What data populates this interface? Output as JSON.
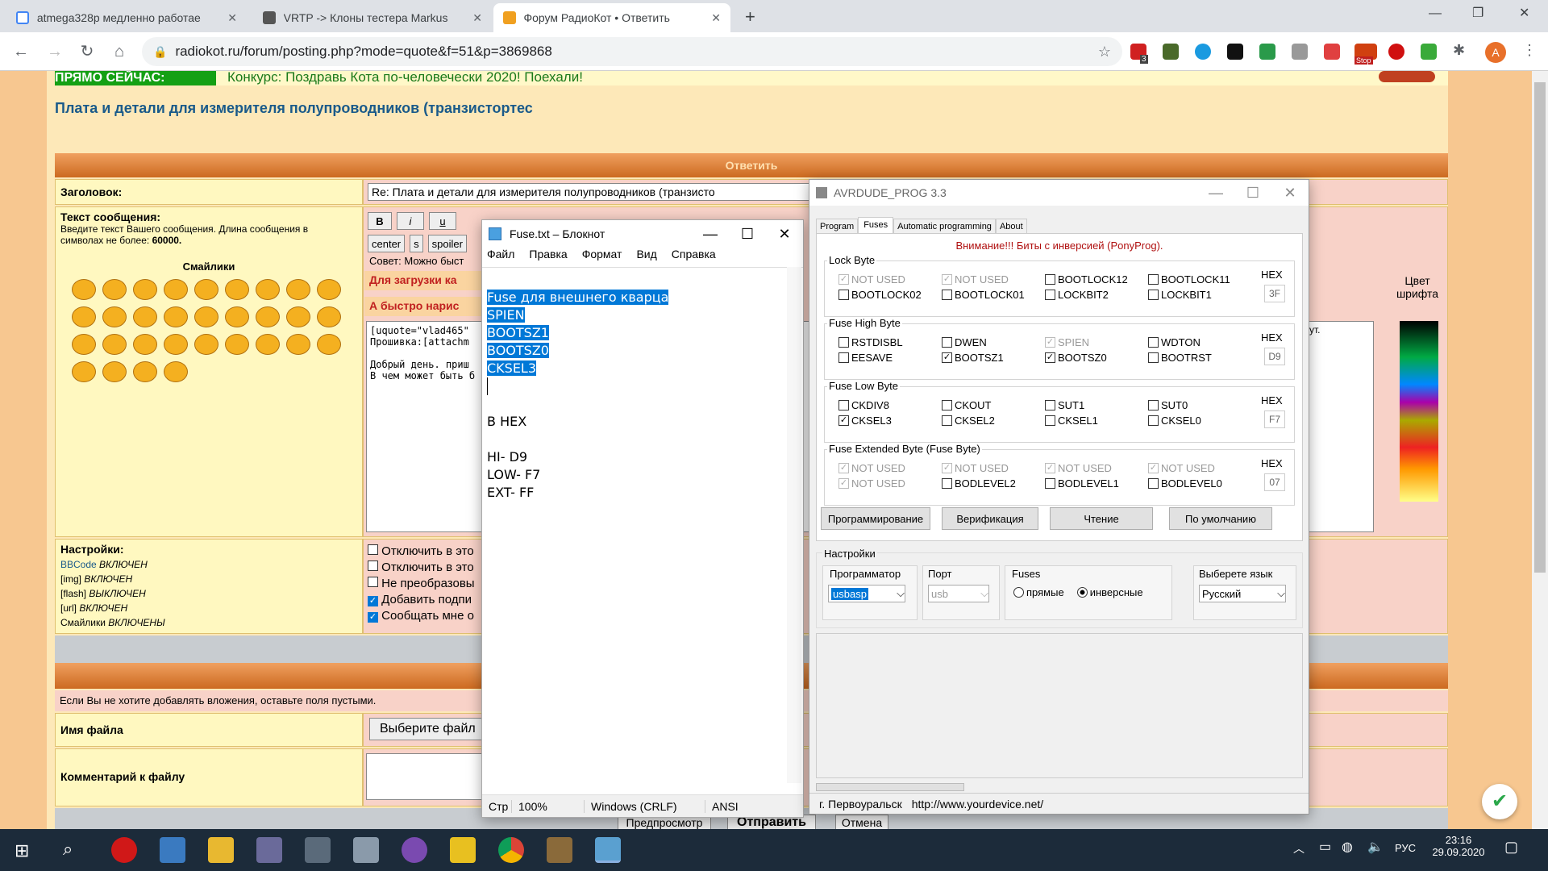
{
  "browser": {
    "tabs": [
      {
        "title": "atmega328p медленно работае",
        "icon": "google-icon"
      },
      {
        "title": "VRTP -> Клоны тестера Markus",
        "icon": "forum-icon"
      },
      {
        "title": "Форум РадиоКот • Ответить",
        "icon": "radiokot-icon"
      }
    ],
    "url": "radiokot.ru/forum/posting.php?mode=quote&f=51&p=3869868",
    "profile_letter": "A",
    "badges": {
      "abp": "3",
      "stop": "Stop"
    }
  },
  "page": {
    "now_badge": "ПРЯМО СЕЙЧАС:",
    "contest": "Конкурс: Поздравь Кота по-человечески 2020! Поехали!",
    "topic_title": "Плата и детали для измерителя полупроводников (транзистортес",
    "reply_header": "Ответить",
    "subject_label": "Заголовок:",
    "subject_value": "Re: Плата и детали для измерителя полупроводников (транзисто",
    "message_label": "Текст сообщения:",
    "message_hint": "Введите текст Вашего сообщения. Длина сообщения в символах не более:",
    "message_max": "60000.",
    "smilies_label": "Смайлики",
    "fmt_buttons": [
      "B",
      "i",
      "u"
    ],
    "fmt_buttons2": [
      "center",
      "s",
      "spoiler"
    ],
    "hint_text": "Совет: Можно быст",
    "upload_text": "Для загрузки ка",
    "quick_text": "А быстро нарис",
    "message_text": "[uquote=\"vlad465\"\nПрошивка:[attachm\n\nДобрый день. приш\nВ чем может быть б",
    "color_label": "Цвет шрифта",
    "side_note": "ут.",
    "settings_label": "Настройки:",
    "settings": [
      {
        "name": "BBCode",
        "state": "ВКЛЮЧЕН"
      },
      {
        "name": "[img]",
        "state": "ВКЛЮЧЕН"
      },
      {
        "name": "[flash]",
        "state": "ВЫКЛЮЧЕН"
      },
      {
        "name": "[url]",
        "state": "ВКЛЮЧЕН"
      },
      {
        "name": "Смайлики",
        "state": "ВКЛЮЧЕНЫ"
      }
    ],
    "options": [
      {
        "label": "Отключить в это",
        "checked": false
      },
      {
        "label": "Отключить в это",
        "checked": false
      },
      {
        "label": "Не преобразовы",
        "checked": false
      },
      {
        "label": "Добавить подпи",
        "checked": true
      },
      {
        "label": "Сообщать мне о",
        "checked": true
      }
    ],
    "attach_hint": "Если Вы не хотите добавлять вложения, оставьте поля пустыми.",
    "file_label": "Имя файла",
    "choose_file": "Выберите файл",
    "comment_label": "Комментарий к файлу",
    "preview_btn": "Предпросмотр",
    "submit_btn": "Отправить",
    "cancel_btn": "Отмена"
  },
  "notepad": {
    "title": "Fuse.txt – Блокнот",
    "menu": [
      "Файл",
      "Правка",
      "Формат",
      "Вид",
      "Справка"
    ],
    "selected_lines": [
      "Fuse для внешнего кварца",
      "SPIEN",
      "BOOTSZ1",
      "BOOTSZ0",
      "CKSEL3"
    ],
    "lines": [
      "В HEX",
      "",
      "HI- D9",
      "LOW- F7",
      "EXT- FF"
    ],
    "status": {
      "pos": "Стр",
      "zoom": "100%",
      "eol": "Windows (CRLF)",
      "enc": "ANSI"
    }
  },
  "avr": {
    "title": "AVRDUDE_PROG 3.3",
    "tabs": [
      "Program",
      "Fuses",
      "Automatic programming",
      "About"
    ],
    "active_tab": "Fuses",
    "warning": "Внимание!!! Биты с инверсией (PonyProg).",
    "hex_label": "HEX",
    "groups": [
      {
        "title": "Lock Byte",
        "hex": "3F",
        "bits": [
          {
            "label": "NOT USED",
            "checked": true,
            "disabled": true
          },
          {
            "label": "NOT USED",
            "checked": true,
            "disabled": true
          },
          {
            "label": "BOOTLOCK12",
            "checked": false,
            "disabled": false
          },
          {
            "label": "BOOTLOCK11",
            "checked": false,
            "disabled": false
          },
          {
            "label": "BOOTLOCK02",
            "checked": false,
            "disabled": false
          },
          {
            "label": "BOOTLOCK01",
            "checked": false,
            "disabled": false
          },
          {
            "label": "LOCKBIT2",
            "checked": false,
            "disabled": false
          },
          {
            "label": "LOCKBIT1",
            "checked": false,
            "disabled": false
          }
        ]
      },
      {
        "title": "Fuse High Byte",
        "hex": "D9",
        "bits": [
          {
            "label": "RSTDISBL",
            "checked": false,
            "disabled": false
          },
          {
            "label": "DWEN",
            "checked": false,
            "disabled": false
          },
          {
            "label": "SPIEN",
            "checked": true,
            "disabled": true
          },
          {
            "label": "WDTON",
            "checked": false,
            "disabled": false
          },
          {
            "label": "EESAVE",
            "checked": false,
            "disabled": false
          },
          {
            "label": "BOOTSZ1",
            "checked": true,
            "disabled": false
          },
          {
            "label": "BOOTSZ0",
            "checked": true,
            "disabled": false
          },
          {
            "label": "BOOTRST",
            "checked": false,
            "disabled": false
          }
        ]
      },
      {
        "title": "Fuse Low Byte",
        "hex": "F7",
        "bits": [
          {
            "label": "CKDIV8",
            "checked": false,
            "disabled": false
          },
          {
            "label": "CKOUT",
            "checked": false,
            "disabled": false
          },
          {
            "label": "SUT1",
            "checked": false,
            "disabled": false
          },
          {
            "label": "SUT0",
            "checked": false,
            "disabled": false
          },
          {
            "label": "CKSEL3",
            "checked": true,
            "disabled": false
          },
          {
            "label": "CKSEL2",
            "checked": false,
            "disabled": false
          },
          {
            "label": "CKSEL1",
            "checked": false,
            "disabled": false
          },
          {
            "label": "CKSEL0",
            "checked": false,
            "disabled": false
          }
        ]
      },
      {
        "title": "Fuse Extended Byte (Fuse Byte)",
        "hex": "07",
        "bits": [
          {
            "label": "NOT USED",
            "checked": true,
            "disabled": true
          },
          {
            "label": "NOT USED",
            "checked": true,
            "disabled": true
          },
          {
            "label": "NOT USED",
            "checked": true,
            "disabled": true
          },
          {
            "label": "NOT USED",
            "checked": true,
            "disabled": true
          },
          {
            "label": "NOT USED",
            "checked": true,
            "disabled": true
          },
          {
            "label": "BODLEVEL2",
            "checked": false,
            "disabled": false
          },
          {
            "label": "BODLEVEL1",
            "checked": false,
            "disabled": false
          },
          {
            "label": "BODLEVEL0",
            "checked": false,
            "disabled": false
          }
        ]
      }
    ],
    "buttons": [
      "Программирование",
      "Верификация",
      "Чтение",
      "По умолчанию"
    ],
    "settings_label": "Настройки",
    "programmer_label": "Программатор",
    "programmer_value": "usbasp",
    "port_label": "Порт",
    "port_value": "usb",
    "fuses_label": "Fuses",
    "fuses_direct": "прямые",
    "fuses_inverse": "инверсные",
    "fuses_selected": "инверсные",
    "lang_label": "Выберете язык",
    "lang_value": "Русский",
    "status_city": "г. Первоуральск",
    "status_url": "http://www.yourdevice.net/"
  },
  "taskbar": {
    "lang": "РУС",
    "time": "23:16",
    "date": "29.09.2020"
  },
  "colors": {
    "accent": "#0078d7",
    "page_bg": "#f7c790",
    "reply_bar": "#cc6a20",
    "title": "#1a5a8a"
  }
}
